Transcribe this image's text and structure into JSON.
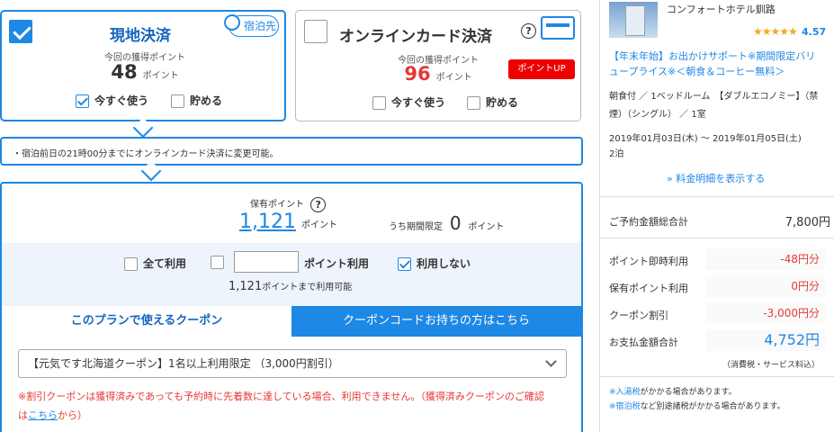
{
  "payment": {
    "local": {
      "title": "現地決済",
      "badge": "宿泊先",
      "points_label": "今回の獲得ポイント",
      "points": "48",
      "unit": "ポイント",
      "opt_now": "今すぐ使う",
      "opt_save": "貯める"
    },
    "online": {
      "title": "オンラインカード決済",
      "help": "?",
      "points_label": "今回の獲得ポイント",
      "points": "96",
      "unit": "ポイント",
      "badge": "ポイントUP",
      "opt_now": "今すぐ使う",
      "opt_save": "貯める"
    }
  },
  "note": "・宿泊前日の21時00分までにオンラインカード決済に変更可能。",
  "points_panel": {
    "owned_label": "保有ポイント",
    "help": "?",
    "owned": "1,121",
    "unit": "ポイント",
    "limited_label": "うち期間限定",
    "limited": "0",
    "use_all": "全て利用",
    "use_points": "ポイント利用",
    "use_none": "利用しない",
    "limit_value": "1,121",
    "limit_text": "ポイントまで利用可能",
    "points_input": ""
  },
  "coupons": {
    "tab_plan": "このプランで使えるクーポン",
    "tab_code": "クーポンコードお持ちの方はこちら",
    "selected": "【元気です北海道クーポン】1名以上利用限定 （3,000円割引）",
    "warning_1": "※割引クーポンは獲得済みであっても予約時に先着数に達している場合、利用できません。（獲得済みクーポンのご確認",
    "warning_2a": "は",
    "warning_link": "こちら",
    "warning_2b": "から）"
  },
  "summary": {
    "hotel": "コンフォートホテル釧路",
    "rating": "4.57",
    "plan": "【年末年始】お出かけサポート※期間限定バリュープライス※＜朝食＆コーヒー無料＞",
    "room": "朝食付 ／ 1ベッドルーム　【ダブルエコノミー】（禁煙）（シングル） ／ 1室",
    "dates": "2019年01月03日(木) 〜 2019年01月05日(土)",
    "nights": "2泊",
    "detail_link": "» 料金明細を表示する",
    "total_label": "ご予約金額総合計",
    "total": "7,800円",
    "instant_label": "ポイント即時利用",
    "instant": "-48円分",
    "held_label": "保有ポイント利用",
    "held": "0円分",
    "coupon_label": "クーポン割引",
    "coupon": "-3,000円分",
    "pay_label": "お支払金額合計",
    "pay": "4,752円",
    "tax": "（消費税・サービス料込）",
    "tax1_link": "※入湯税",
    "tax1": "がかかる場合があります。",
    "tax2_link": "※宿泊税",
    "tax2": "など別途諸税がかかる場合があります。"
  },
  "colors": {
    "accent": "#1e88e5",
    "red": "#e53935",
    "star": "#f5a623"
  }
}
